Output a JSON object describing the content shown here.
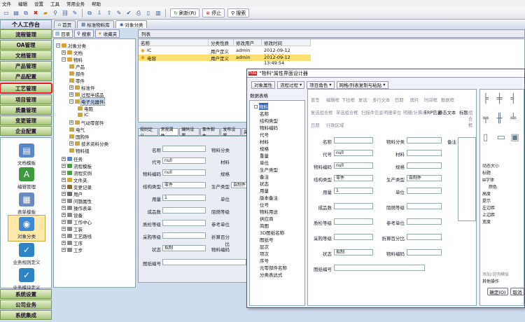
{
  "menu": [
    "文件",
    "编辑",
    "设置",
    "工具",
    "常用业务",
    "帮助"
  ],
  "toolbar": {
    "refresh": "刷新(R)",
    "stop": "停止",
    "search": "搜索"
  },
  "left_header": "个人工作台",
  "nav": [
    "流程管理",
    "OA管理",
    "文档管理",
    "产品管理",
    "产品配置",
    "工艺管理",
    "项目管理",
    "质量管理",
    "变更管理",
    "企业配置"
  ],
  "nav_bottom": [
    "系统设置",
    "公司业务",
    "系统集成"
  ],
  "big_icons": [
    "文档模板",
    "编辑管理",
    "表单模板",
    "对象分类",
    "业务规则定义",
    "业务模块定义"
  ],
  "tabs": [
    "首页",
    "标准物料库",
    "对象分类"
  ],
  "subtabs": [
    "目录",
    "搜索",
    "收藏夹"
  ],
  "tree": [
    "对象分类",
    "文档",
    "物料",
    "产品",
    "部件",
    "零件",
    "标准件",
    "过程半成品",
    "电子元器件",
    "电阻",
    "IC",
    "气动零部件",
    "电气",
    "国购件",
    "技术资料分类",
    "物料组",
    "任务",
    "流程模板",
    "流程实例",
    "文件夹",
    "变更记录",
    "用户",
    "问题属性",
    "操作表单",
    "设备",
    "工作中心",
    "工装",
    "工艺路线",
    "工序",
    "工步"
  ],
  "list": {
    "title": "列表",
    "headers": [
      "名称",
      "分类性质",
      "修改用户",
      "修改时间"
    ],
    "rows": [
      {
        "name": "IC",
        "type": "用户定义",
        "user": "admin",
        "time": "2012-09-12 13:50:11"
      },
      {
        "name": "电容",
        "type": "用户定义",
        "user": "admin",
        "time": "2012-09-12 13:49:54"
      }
    ]
  },
  "prop_tabs": [
    "规则定义",
    "常规属性",
    "编码设置",
    "事件脚本",
    "发布设置",
    "属"
  ],
  "props": {
    "labels": [
      "名称",
      "代号",
      "物料编码",
      "结构类型",
      "用量",
      "成品数",
      "质检等级",
      "参考单位",
      "采购等级",
      "状态",
      "图纸编号",
      "物料分类",
      "材料",
      "规格",
      "单位",
      "生产类型",
      "单位",
      "阻燃等级",
      "折算单位",
      "折算百分比",
      "物料编码"
    ],
    "code_val": "null",
    "matcode_val": "null",
    "struct_val": "零件",
    "qty_val": "1",
    "status_val": "拟制",
    "prodtype_val": "自制件"
  },
  "dialog": {
    "title": "\"物料\"属性界面设计器",
    "badge": "Pole",
    "buttons": [
      "对象属性",
      "流程过程",
      "项目角色",
      "网格/列表复制与粘贴"
    ],
    "list_title": "数据表格",
    "items": [
      "物料",
      "名称",
      "结构类型",
      "物料编码",
      "代号",
      "材料",
      "规格",
      "重量",
      "单位",
      "生产类型",
      "备注",
      "状态",
      "用量",
      "版本备注",
      "位号",
      "物料用途",
      "供应商",
      "简图",
      "3D图纸名称",
      "图纸号",
      "层次",
      "项次",
      "序号",
      "元零部件名称",
      "分类表达式"
    ],
    "toolbar_row1": [
      "普签",
      "编辑框",
      "下拉框",
      "复选",
      "多行文本",
      "日期",
      "图片",
      "时间框",
      "数据框"
    ],
    "toolbar_row2": [
      "复选组合框",
      "单选组合框",
      "扫描件信息",
      "明细单位",
      "明细/计算行",
      "ERP信息",
      "静态文本",
      "标题",
      "组合框"
    ],
    "toolbar_row3": [
      "日期",
      "行政区域"
    ],
    "form_labels": [
      "名称",
      "代号",
      "物料编码",
      "结构类型",
      "用量",
      "成品数",
      "质检等级",
      "参考单位",
      "采购等级",
      "状态",
      "图纸编号",
      "物料分类",
      "材料",
      "规格",
      "生产类型",
      "单位",
      "阻燃等级",
      "折算单位",
      "折算百分比",
      "物料编码",
      "备注"
    ],
    "form_vals": {
      "code": "null",
      "matcode": "null",
      "struct": "零件",
      "qty": "1",
      "status": "拟制",
      "prodtype": "自制件"
    },
    "right_props": [
      "动态大小",
      "标题",
      "字体",
      "颜色",
      "高度",
      "提示",
      "左边距",
      "上边距",
      "宽度"
    ],
    "right_bottom": "添加/说明模版",
    "right_bottom2": "其他操作",
    "ok": "确定(O)",
    "cancel": "取消"
  }
}
